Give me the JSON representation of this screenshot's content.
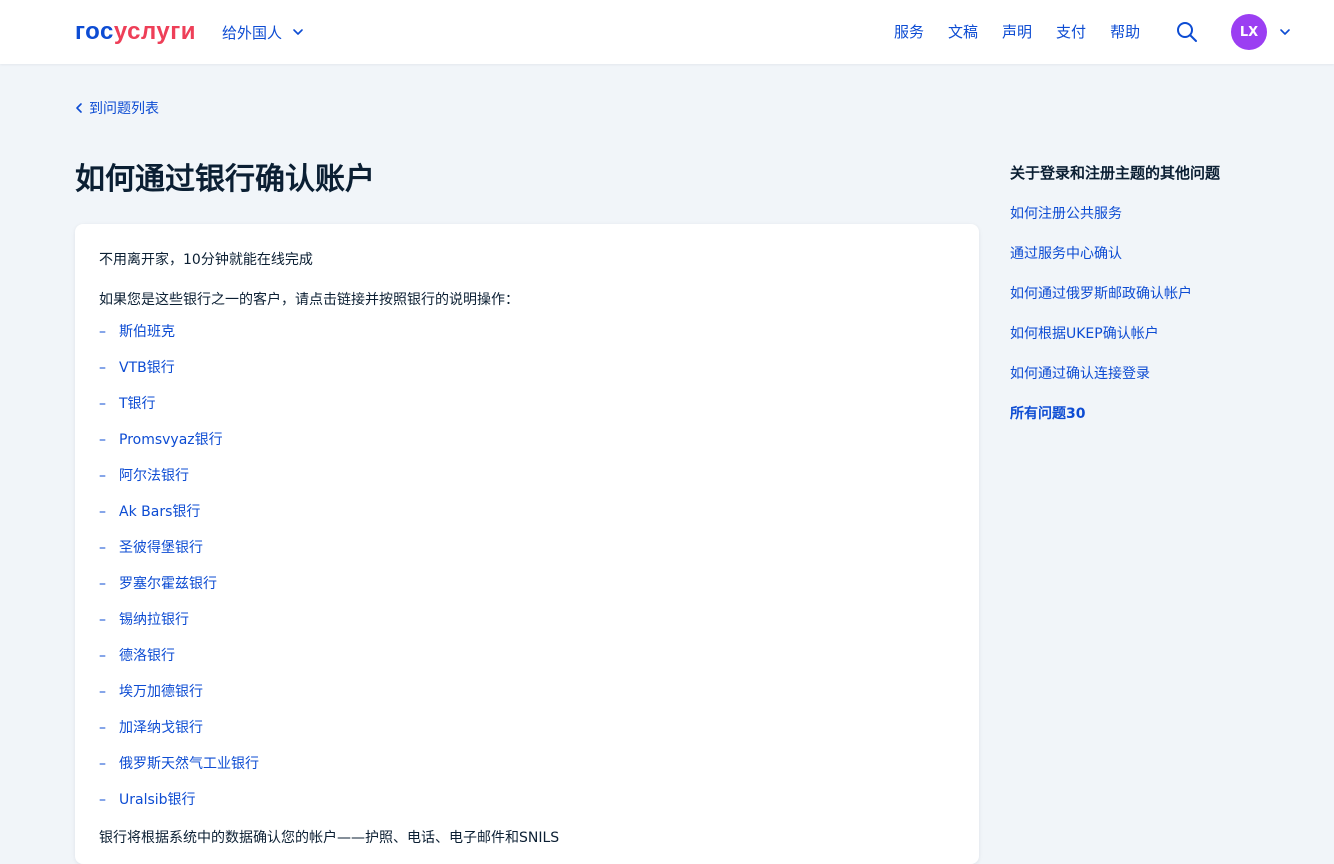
{
  "header": {
    "logo_part1": "гос",
    "logo_part2": "услуги",
    "language_label": "给外国人",
    "nav": [
      "服务",
      "文稿",
      "声明",
      "支付",
      "帮助"
    ],
    "avatar_initials": "LX"
  },
  "back_link": "到问题列表",
  "title": "如何通过银行确认账户",
  "card": {
    "intro": "不用离开家，10分钟就能在线完成",
    "lead": "如果您是这些银行之一的客户，请点击链接并按照银行的说明操作：",
    "dash": "–",
    "banks": [
      "斯伯班克",
      "VTB银行",
      "T银行",
      "Promsvyaz银行",
      "阿尔法银行",
      "Ak Bars银行",
      "圣彼得堡银行",
      "罗塞尔霍兹银行",
      "锡纳拉银行",
      "德洛银行",
      "埃万加德银行",
      "加泽纳戈银行",
      "俄罗斯天然气工业银行",
      "Uralsib银行"
    ],
    "footnote": "银行将根据系统中的数据确认您的帐户——护照、电话、电子邮件和SNILS"
  },
  "aside": {
    "title": "关于登录和注册主题的其他问题",
    "links": [
      "如何注册公共服务",
      "通过服务中心确认",
      "如何通过俄罗斯邮政确认帐户",
      "如何根据UKEP确认帐户",
      "如何通过确认连接登录"
    ],
    "all_label": "所有问题30"
  },
  "colors": {
    "link": "#0d4cd3",
    "text": "#0b1f33",
    "background": "#f1f5f9",
    "avatar": "#9b3ff2",
    "logo_accent": "#ee3f58"
  },
  "icons": [
    "chevron-down-icon",
    "search-icon",
    "chevron-left-icon"
  ]
}
